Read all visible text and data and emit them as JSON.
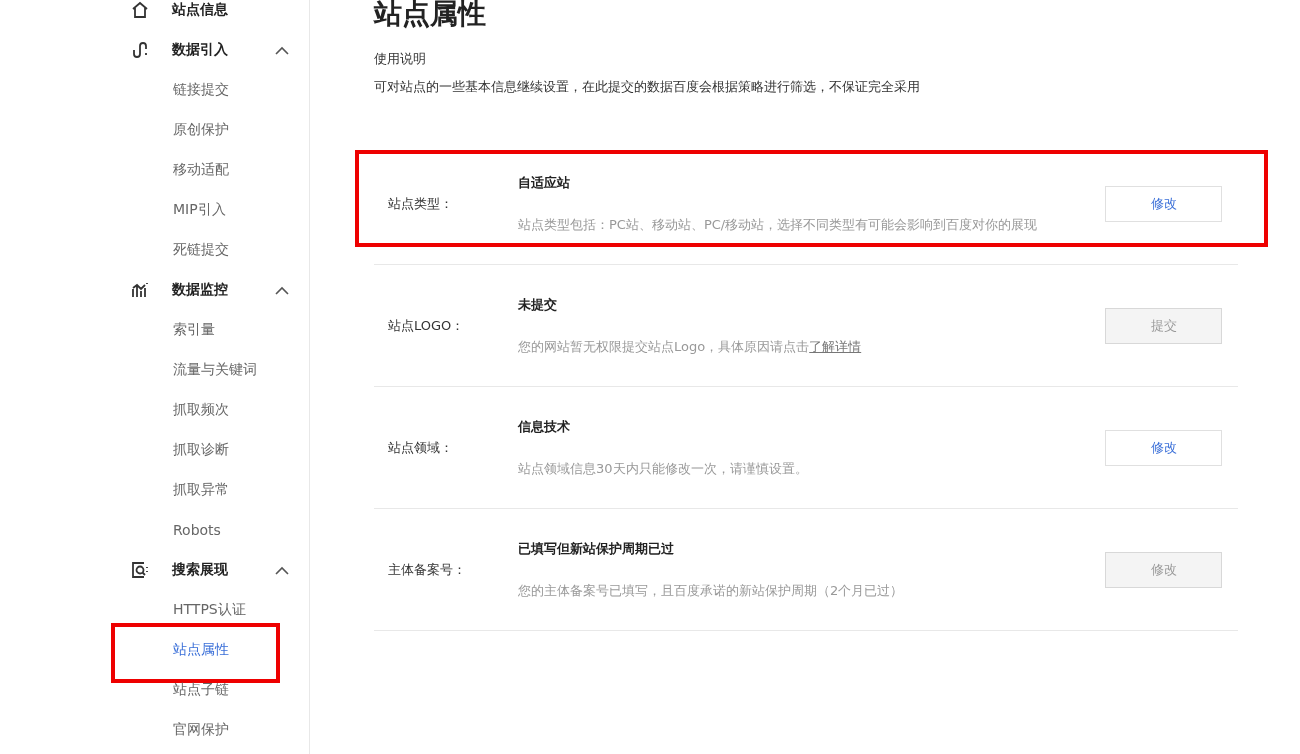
{
  "sidebar": {
    "groups": [
      {
        "kind": "home",
        "label": "站点信息"
      },
      {
        "kind": "import",
        "label": "数据引入",
        "expanded": true,
        "items": [
          {
            "label": "链接提交",
            "selected": false,
            "highlighted": false
          },
          {
            "label": "原创保护",
            "selected": false,
            "highlighted": false
          },
          {
            "label": "移动适配",
            "selected": false,
            "highlighted": false
          },
          {
            "label": "MIP引入",
            "selected": false,
            "highlighted": false
          },
          {
            "label": "死链提交",
            "selected": false,
            "highlighted": false
          }
        ]
      },
      {
        "kind": "monitor",
        "label": "数据监控",
        "expanded": true,
        "items": [
          {
            "label": "索引量",
            "selected": false,
            "highlighted": false
          },
          {
            "label": "流量与关键词",
            "selected": false,
            "highlighted": false
          },
          {
            "label": "抓取频次",
            "selected": false,
            "highlighted": false
          },
          {
            "label": "抓取诊断",
            "selected": false,
            "highlighted": false
          },
          {
            "label": "抓取异常",
            "selected": false,
            "highlighted": false
          },
          {
            "label": "Robots",
            "selected": false,
            "highlighted": false
          }
        ]
      },
      {
        "kind": "search",
        "label": "搜索展现",
        "expanded": true,
        "items": [
          {
            "label": "HTTPS认证",
            "selected": false,
            "highlighted": false
          },
          {
            "label": "站点属性",
            "selected": true,
            "highlighted": true
          },
          {
            "label": "站点子链",
            "selected": false,
            "highlighted": false
          },
          {
            "label": "官网保护",
            "selected": false,
            "highlighted": false
          }
        ]
      }
    ]
  },
  "page": {
    "title": "站点属性",
    "intro_heading": "使用说明",
    "intro_text": "可对站点的一些基本信息继续设置，在此提交的数据百度会根据策略进行筛选，不保证完全采用"
  },
  "properties": [
    {
      "label": "站点类型：",
      "value": "自适应站",
      "description": "站点类型包括：PC站、移动站、PC/移动站，选择不同类型有可能会影响到百度对你的展现",
      "button": "修改",
      "disabled": false,
      "highlighted": true
    },
    {
      "label": "站点LOGO：",
      "value": "未提交",
      "description": "您的网站暂无权限提交站点Logo，具体原因请点击",
      "link": "了解详情",
      "button": "提交",
      "disabled": true,
      "highlighted": false
    },
    {
      "label": "站点领域：",
      "value": "信息技术",
      "description": "站点领域信息30天内只能修改一次，请谨慎设置。",
      "button": "修改",
      "disabled": false,
      "highlighted": false
    },
    {
      "label": "主体备案号：",
      "value": "已填写但新站保护周期已过",
      "description": "您的主体备案号已填写，且百度承诺的新站保护周期（2个月已过）",
      "button": "修改",
      "disabled": true,
      "highlighted": false
    }
  ]
}
